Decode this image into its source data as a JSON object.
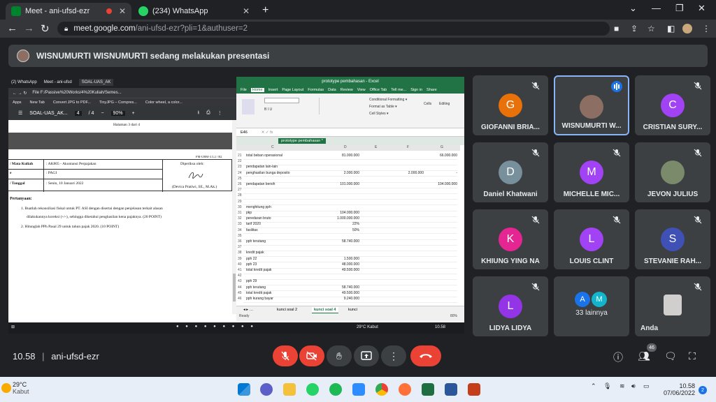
{
  "tabs": [
    {
      "title": "Meet - ani-ufsd-ezr",
      "color": "#e8eaed"
    },
    {
      "title": "(234) WhatsApp",
      "color": "#25d366"
    }
  ],
  "address": {
    "host": "meet.google.com",
    "path": "/ani-ufsd-ezr?pli=1&authuser=2"
  },
  "banner": {
    "text": "WISNUMURTI WISNUMURTI sedang melakukan presentasi"
  },
  "presentation": {
    "pdf": {
      "tabs": [
        "(2) WhatsApp",
        "Meet - ani-ufsd",
        "SOAL-UAS_AK"
      ],
      "url": "File  F:/Passive%20Works/4%20Kuliah/Semes...",
      "bookmarks": [
        "Apps",
        "New Tab",
        "Convert JPG to PDF...",
        "TinyJPG – Compres...",
        "Color wheel, a color..."
      ],
      "title": "SOAL-UAS_AK...",
      "page": "4",
      "pages": "/ 4",
      "zoom": "90%",
      "header": "Halaman 3 dari 4",
      "code": "FM-UBM-3.3.2 / R2",
      "rows": [
        {
          "label": "/ Mata Kuliah",
          "value": ": AK805 - Akuntansi Perpajakan",
          "right": "Diperiksa oleh:"
        },
        {
          "label": "e",
          "value": ": PAGI",
          "right": ""
        },
        {
          "label": "/ Tanggal",
          "value": ": Senin, 10 Januari 2022",
          "right": "(Devica Pratiwi, SE., M.Ak.)"
        }
      ],
      "section": "Pertanyaan:",
      "q1a": "1.  Buatlah rekonsiliasi fiskal untuk PT. ASI dengan disertai dengan penjelasan terkait alasan",
      "q1b": "dilakukannya koreksi (+/-), sehingga diketahui penghasilan kena pajaknya. (20 POINT)",
      "q2": "2.  Hitunglah PPh Pasal 29 untuk tahun pajak 2020. (10 POINT)"
    },
    "excel": {
      "title": "prototype pembahasan - Excel",
      "menu": [
        "File",
        "Home",
        "Insert",
        "Page Layout",
        "Formulas",
        "Data",
        "Review",
        "View",
        "Office Tab",
        "Tell me...",
        "Sign in",
        "Share"
      ],
      "namebox": "E46",
      "doc_tab": "prototype pembahasan *",
      "cols": [
        "C",
        "D",
        "E",
        "F",
        "G"
      ],
      "rows": [
        {
          "n": "21",
          "c": "total beban operasional",
          "d": "81.000.000",
          "g": "66.000.000"
        },
        {
          "n": "22",
          "c": "",
          "d": "",
          "g": ""
        },
        {
          "n": "23",
          "c": "pendapatan lain-lain",
          "d": "",
          "g": ""
        },
        {
          "n": "24",
          "c": "penghasilan bunga deposito",
          "d": "2.000.000",
          "f": "2.000.000",
          "g": "-"
        },
        {
          "n": "25",
          "c": "",
          "d": "",
          "g": ""
        },
        {
          "n": "26",
          "c": "pendapatan bersih",
          "d": "101.000.000",
          "g": "104.000.000"
        },
        {
          "n": "27",
          "c": "",
          "d": "",
          "g": ""
        },
        {
          "n": "28",
          "c": "",
          "d": "",
          "g": ""
        },
        {
          "n": "29",
          "c": "",
          "d": "",
          "g": ""
        },
        {
          "n": "30",
          "c": "menghitung pph",
          "d": "",
          "g": ""
        },
        {
          "n": "31",
          "c": "pkp",
          "d": "104.000.000",
          "g": ""
        },
        {
          "n": "32",
          "c": "peredaran bruto",
          "d": "1.000.000.000",
          "g": ""
        },
        {
          "n": "33",
          "c": "tarif 2020",
          "d": "22%",
          "g": ""
        },
        {
          "n": "34",
          "c": "fasilitas",
          "d": "50%",
          "g": ""
        },
        {
          "n": "35",
          "c": "",
          "d": "",
          "g": ""
        },
        {
          "n": "36",
          "c": "pph terutang",
          "d": "58.740.000",
          "g": ""
        },
        {
          "n": "37",
          "c": "",
          "d": "",
          "g": ""
        },
        {
          "n": "38",
          "c": "kredit pajak",
          "d": "",
          "g": ""
        },
        {
          "n": "39",
          "c": "pph 22",
          "d": "1.500.000",
          "g": ""
        },
        {
          "n": "40",
          "c": "pph 23",
          "d": "48.000.000",
          "g": ""
        },
        {
          "n": "41",
          "c": "total kredit pajak",
          "d": "49.500.000",
          "g": ""
        },
        {
          "n": "42",
          "c": "",
          "d": "",
          "g": ""
        },
        {
          "n": "43",
          "c": "pph 29",
          "d": "",
          "g": ""
        },
        {
          "n": "44",
          "c": "pph terutang",
          "d": "58.740.000",
          "g": ""
        },
        {
          "n": "45",
          "c": "total kredit pajak",
          "d": "49.500.000",
          "g": ""
        },
        {
          "n": "46",
          "c": "pph kurang bayar",
          "d": "9.240.000",
          "g": ""
        }
      ],
      "sheets": [
        "kunci soal 2",
        "kunci soal 4",
        "kunci"
      ],
      "status": "Ready",
      "zoom": "80%"
    },
    "inner_taskbar": {
      "weather": "29°C Kabut",
      "time": "10.58"
    }
  },
  "tiles": [
    {
      "name": "GIOFANNI BRIA...",
      "initial": "G",
      "color": "#e8710a"
    },
    {
      "name": "WISNUMURTI W...",
      "initial": "",
      "color": "#8d6e63",
      "speaking": true
    },
    {
      "name": "CRISTIAN SURY...",
      "initial": "C",
      "color": "#a142f4"
    },
    {
      "name": "Daniel Khatwani",
      "initial": "D",
      "color": "#78909c"
    },
    {
      "name": "MICHELLE MIC...",
      "initial": "M",
      "color": "#a142f4"
    },
    {
      "name": "JEVON JULIUS",
      "initial": "",
      "color": "#7a8a6a"
    },
    {
      "name": "KHIUNG YING NA",
      "initial": "K",
      "color": "#e52592"
    },
    {
      "name": "LOUIS CLINT",
      "initial": "L",
      "color": "#a142f4"
    },
    {
      "name": "STEVANIE RAH...",
      "initial": "S",
      "color": "#3f51b5"
    },
    {
      "name": "LIDYA LIDYA",
      "initial": "L",
      "color": "#9334e6"
    },
    {
      "name": "33 lainnya",
      "initial": "",
      "color": ""
    },
    {
      "name": "Anda",
      "initial": "",
      "color": "#d0cfcd"
    }
  ],
  "others": {
    "a": "A",
    "m": "M",
    "a_color": "#1a73e8",
    "m_color": "#12b5cb"
  },
  "meeting": {
    "time": "10.58",
    "code": "ani-ufsd-ezr",
    "participants": "46"
  },
  "win": {
    "temp": "29°C",
    "cond": "Kabut",
    "time": "10.58",
    "date": "07/06/2022",
    "notif": "2"
  }
}
